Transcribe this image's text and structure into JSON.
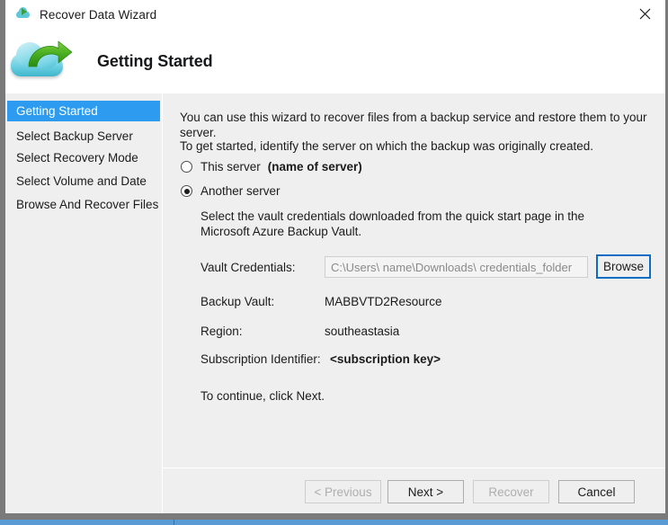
{
  "window": {
    "title": "Recover Data Wizard",
    "titlebar_icon": "cloud-restore-icon",
    "close_label": "×"
  },
  "header": {
    "logo_icon": "cloud-restore-logo",
    "title": "Getting Started"
  },
  "sidebar": {
    "items": [
      {
        "label": "Getting Started",
        "active": true
      },
      {
        "label": "Select Backup Server",
        "active": false
      },
      {
        "label": "Select Recovery Mode",
        "active": false
      },
      {
        "label": "Select Volume and Date",
        "active": false
      },
      {
        "label": "Browse And Recover Files",
        "active": false
      }
    ]
  },
  "main": {
    "intro_line": "You can use this wizard to recover files from a backup service and restore them to your server.",
    "instruction_line": "To get started, identify the server on which the backup was originally created.",
    "radios": [
      {
        "label": "This server",
        "sublabel": "(name of server)",
        "selected": false
      },
      {
        "label": "Another server",
        "sublabel": "",
        "selected": true
      }
    ],
    "vault_help": "Select the vault credentials downloaded from the quick start page in the Microsoft Azure Backup Vault.",
    "vault_credentials_label": "Vault Credentials:",
    "vault_credentials_placeholder": "C:\\Users\\ name\\Downloads\\ credentials_folder",
    "vault_credentials_value": "",
    "browse_label": "Browse",
    "backup_vault_label": "Backup Vault:",
    "backup_vault_value": "MABBVTD2Resource",
    "region_label": "Region:",
    "region_value": "southeastasia",
    "subscription_label": "Subscription Identifier:",
    "subscription_value": "<subscription key>",
    "continue_line": "To continue, click Next."
  },
  "footer": {
    "previous_label": "< Previous",
    "next_label": "Next >",
    "recover_label": "Recover",
    "cancel_label": "Cancel"
  },
  "colors": {
    "accent_blue": "#2d9bf0",
    "focus_blue": "#0a6cc4",
    "body_gray": "#efefef",
    "frame_gray": "#7a7a7a",
    "bottom_blue": "#5b9bd5"
  }
}
